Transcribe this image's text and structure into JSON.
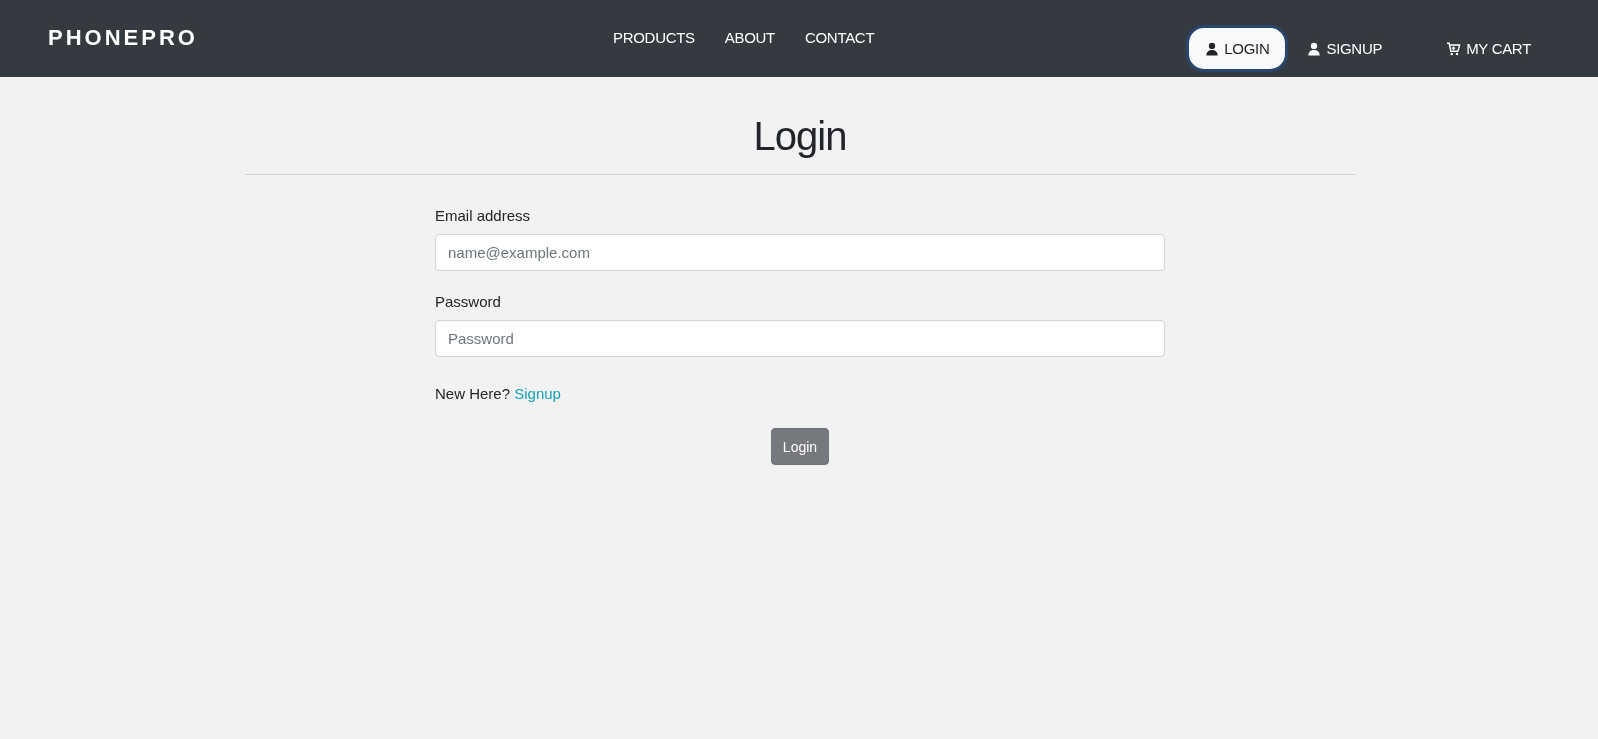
{
  "navbar": {
    "brand": "PHONEPRO",
    "links": [
      {
        "label": "PRODUCTS"
      },
      {
        "label": "ABOUT"
      },
      {
        "label": "CONTACT"
      }
    ],
    "actions": [
      {
        "label": "LOGIN",
        "kind": "user",
        "selected": true
      },
      {
        "label": "SIGNUP",
        "kind": "user",
        "selected": false
      },
      {
        "label": "MY CART",
        "kind": "cart",
        "selected": false
      }
    ]
  },
  "page": {
    "title": "Login",
    "fields": [
      {
        "label": "Email address",
        "placeholder": "name@example.com"
      },
      {
        "label": "Password",
        "placeholder": "Password"
      }
    ],
    "signup_prompt": {
      "text": "New Here?",
      "link": "Signup"
    },
    "submit": "Login"
  }
}
